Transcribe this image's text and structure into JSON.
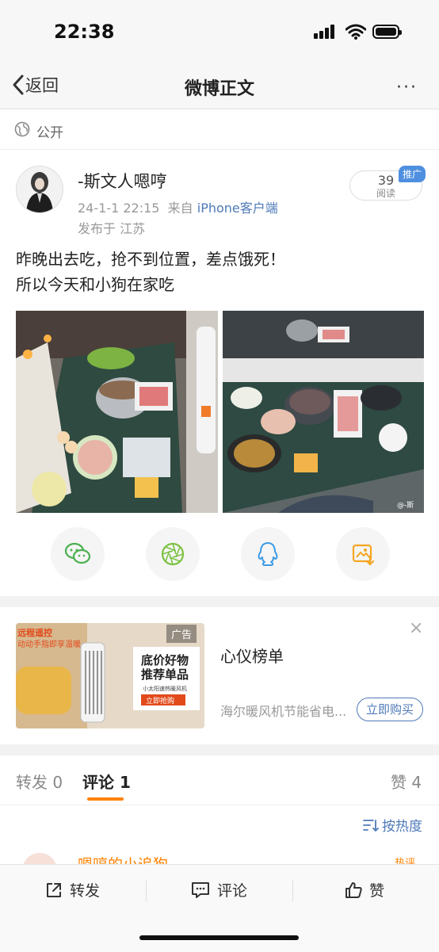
{
  "status": {
    "time": "22:38"
  },
  "nav": {
    "back_label": "返回",
    "title": "微博正文",
    "more": "···"
  },
  "visibility": {
    "label": "公开"
  },
  "post": {
    "author": "-斯文人嗯哼",
    "date": "24-1-1 22:15",
    "source_prefix": "来自",
    "source": "iPhone客户端",
    "location": "发布于 江苏",
    "read_count": "39",
    "read_label": "阅读",
    "promo_tag": "推广",
    "text_line1": "昨晚出去吃，抢不到位置，差点饿死！",
    "text_line2": "所以今天和小狗在家吃",
    "watermark": "@-斯"
  },
  "ad": {
    "tag": "广告",
    "title": "心仪榜单",
    "desc": "海尔暖风机节能省电...",
    "button": "立即购买",
    "close": "×",
    "img_headline1": "底价好物",
    "img_headline2": "推荐单品",
    "img_sub": "小太阳速热暖风机",
    "img_cta": "立即抢购",
    "img_top1": "远程遥控",
    "img_top2": "动动手指即享温暖"
  },
  "tabs": {
    "repost": "转发",
    "repost_count": "0",
    "comment": "评论",
    "comment_count": "1",
    "like": "赞",
    "like_count": "4"
  },
  "sort": {
    "label": "按热度"
  },
  "comment_peek": {
    "name": "嗯哼的小追狗",
    "badge": "热评"
  },
  "bottom": {
    "repost": "转发",
    "comment": "评论",
    "like": "赞"
  },
  "colors": {
    "accent": "#ff8200",
    "link": "#4e7ab8",
    "promo": "#4e8fe0"
  }
}
